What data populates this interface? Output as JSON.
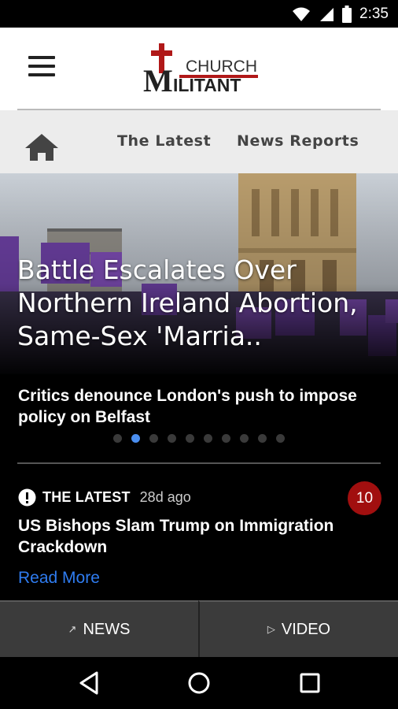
{
  "status_bar": {
    "time": "2:35",
    "icons": [
      "wifi-icon",
      "cell-signal-icon",
      "battery-icon"
    ]
  },
  "header": {
    "menu_icon": "hamburger-menu-icon",
    "logo_word_top": "CHURCH",
    "logo_initial": "M",
    "logo_word_bottom": "ILITANT"
  },
  "nav": {
    "home_icon": "home-icon",
    "tabs": [
      {
        "label": "The Latest"
      },
      {
        "label": "News Reports"
      }
    ]
  },
  "hero": {
    "title": "Battle Escalates Over Northern Ireland Abortion, Same-Sex 'Marria..",
    "subtitle": "Critics denounce London's push to impose policy on Belfast",
    "slides_total": 10,
    "active_slide": 2
  },
  "article": {
    "category_icon": "exclamation-circle-icon",
    "category": "THE LATEST",
    "time_ago": "28d ago",
    "comment_count": "10",
    "title": "US Bishops Slam Trump on Immigration Crackdown",
    "read_more": "Read More"
  },
  "bottom_tabs": [
    {
      "icon": "trend-arrow-icon",
      "glyph": "↗",
      "label": "NEWS"
    },
    {
      "icon": "play-icon",
      "glyph": "▷",
      "label": "VIDEO"
    }
  ],
  "colors": {
    "accent_blue": "#2f7cf0",
    "badge_red": "#a10f0f",
    "active_dot": "#4a8ef0",
    "logo_red": "#b01818"
  }
}
